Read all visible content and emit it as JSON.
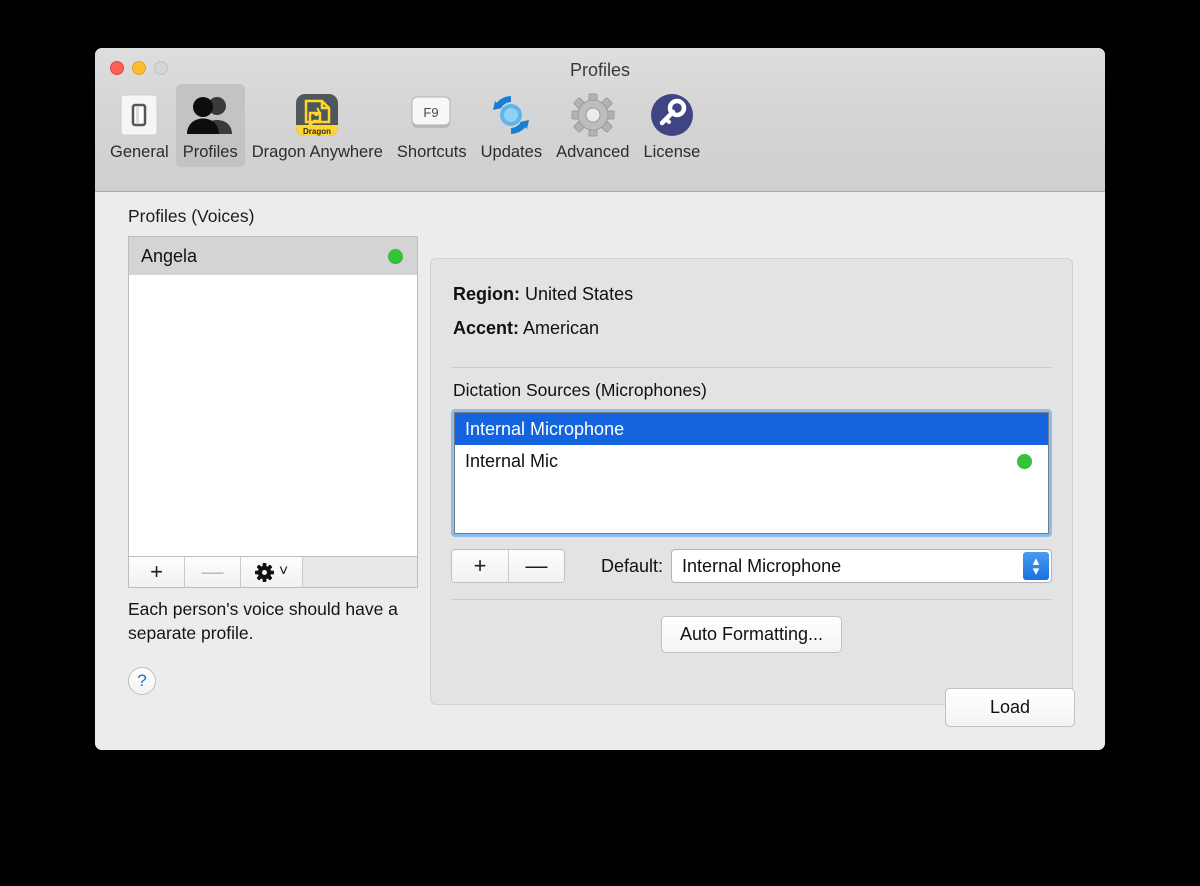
{
  "window": {
    "title": "Profiles",
    "traffic_lights": [
      "close",
      "minimize",
      "zoom"
    ]
  },
  "toolbar": {
    "items": [
      {
        "label": "General",
        "icon": "light-switch-icon",
        "selected": false
      },
      {
        "label": "Profiles",
        "icon": "two-people-icon",
        "selected": true
      },
      {
        "label": "Dragon Anywhere",
        "icon": "dragon-app-icon",
        "selected": false
      },
      {
        "label": "Shortcuts",
        "icon": "f9-key-icon",
        "selected": false
      },
      {
        "label": "Updates",
        "icon": "refresh-circle-icon",
        "selected": false
      },
      {
        "label": "Advanced",
        "icon": "gear-icon",
        "selected": false
      },
      {
        "label": "License",
        "icon": "key-icon",
        "selected": false
      }
    ]
  },
  "left": {
    "heading": "Profiles (Voices)",
    "profiles": [
      {
        "name": "Angela",
        "selected": true,
        "status_dot": true
      }
    ],
    "add_label": "+",
    "remove_label": "—",
    "gear_label": "⚙",
    "gear_chevron": "˅",
    "note": "Each person's voice should have a separate profile.",
    "help_label": "?"
  },
  "right": {
    "region_label": "Region:",
    "region_value": "United States",
    "accent_label": "Accent:",
    "accent_value": "American",
    "dictation_heading": "Dictation Sources (Microphones)",
    "microphones": [
      {
        "name": "Internal Microphone",
        "selected": true,
        "status_dot": false
      },
      {
        "name": "Internal Mic",
        "selected": false,
        "status_dot": true
      }
    ],
    "add_label": "+",
    "remove_label": "—",
    "default_label": "Default:",
    "default_value": "Internal Microphone",
    "stepper_up": "▴",
    "stepper_down": "▾",
    "auto_formatting_label": "Auto Formatting..."
  },
  "footer": {
    "load_label": "Load"
  },
  "colors": {
    "selection_blue": "#1464e0",
    "status_green": "#35c33a",
    "accent_blue": "#1771e0",
    "focus_ring": "#8fbcf0",
    "window_bg": "#ececec",
    "toolbar_bg": "#d4d4d4"
  }
}
